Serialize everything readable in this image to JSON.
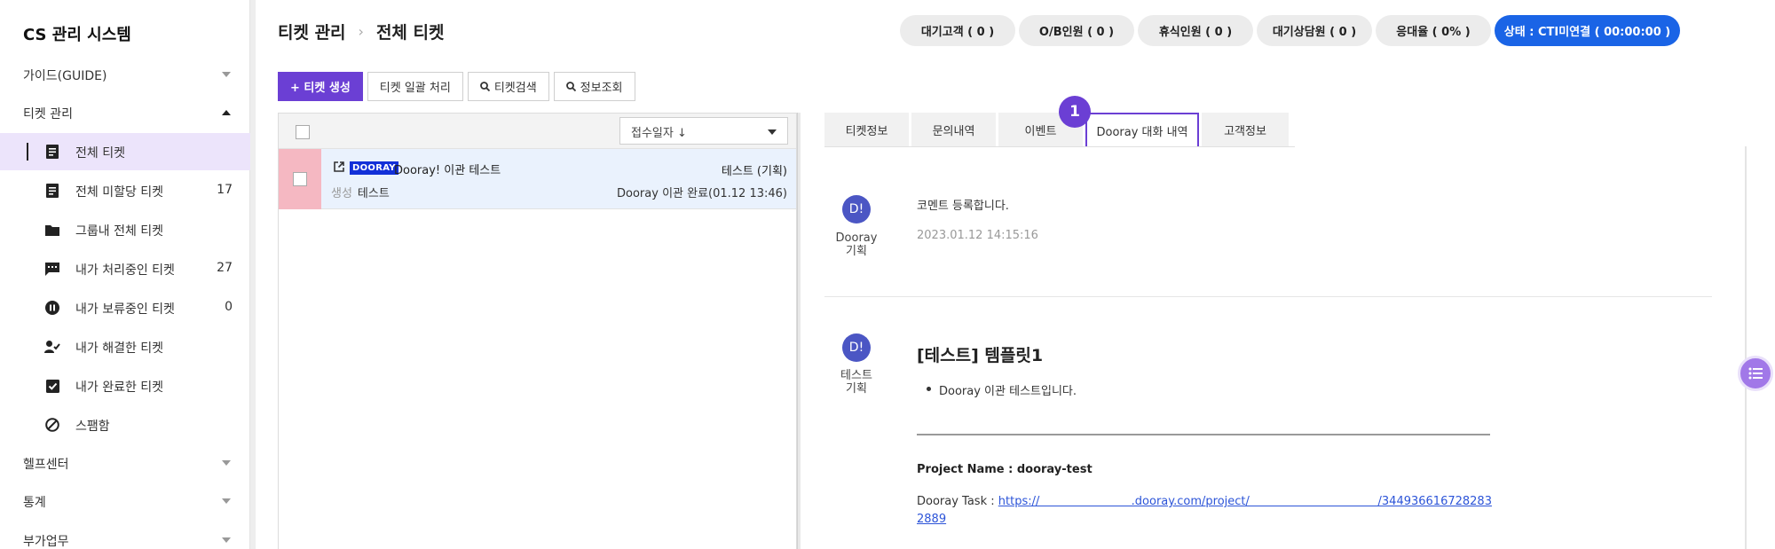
{
  "app": {
    "title": "CS 관리 시스템"
  },
  "sidebar": {
    "guide": "가이드(GUIDE)",
    "ticket_mgmt": "티켓 관리",
    "items": [
      {
        "label": "전체 티켓",
        "count": "",
        "icon": "document-icon"
      },
      {
        "label": "전체 미할당 티켓",
        "count": "17",
        "icon": "document-icon"
      },
      {
        "label": "그룹내 전체 티켓",
        "count": "",
        "icon": "folder-icon"
      },
      {
        "label": "내가 처리중인 티켓",
        "count": "27",
        "icon": "chat-icon"
      },
      {
        "label": "내가 보류중인 티켓",
        "count": "0",
        "icon": "pause-icon"
      },
      {
        "label": "내가 해결한 티켓",
        "count": "",
        "icon": "user-check-icon"
      },
      {
        "label": "내가 완료한 티켓",
        "count": "",
        "icon": "checkbox-icon"
      },
      {
        "label": "스팸함",
        "count": "",
        "icon": "block-icon"
      }
    ],
    "helpcenter": "헬프센터",
    "stats": "통계",
    "extra": "부가업무"
  },
  "header": {
    "breadcrumb_root": "티켓 관리",
    "breadcrumb_current": "전체 티켓",
    "pills": {
      "waiting_customers": "대기고객 ( 0 )",
      "ob_agents": "O/B인원 ( 0 )",
      "resting_agents": "휴식인원 ( 0 )",
      "waiting_agents": "대기상담원 ( 0 )",
      "response_rate": "응대율 ( 0% )",
      "status": "상태 : CTI미연결 ( 00:00:00 )"
    }
  },
  "toolbar": {
    "create": "+ 티켓 생성",
    "bulk": "티켓 일괄 처리",
    "search": "티켓검색",
    "info": "정보조회"
  },
  "list": {
    "sort_label": "접수일자 ↓",
    "ticket": {
      "brand": "DOORAY",
      "title": "Dooray! 이관 테스트",
      "tag": "생성",
      "customer": "테스트",
      "assignee": "테스트 (기획)",
      "state": "Dooray 이관 완료(01.12 13:46)"
    }
  },
  "tabs": {
    "ticket_info": "티켓정보",
    "inquiry": "문의내역",
    "event": "이벤트",
    "dooray": "Dooray 대화 내역",
    "customer": "고객정보",
    "badge": "1"
  },
  "comments": {
    "first": {
      "avatar": "D!",
      "author_line1": "Dooray",
      "author_line2": "기획",
      "text": "코멘트 등록합니다.",
      "date": "2023.01.12 14:15:16"
    },
    "second": {
      "avatar": "D!",
      "author_line1": "테스트",
      "author_line2": "기획",
      "heading": "[테스트] 템플릿1",
      "bullet": "Dooray 이관 테스트입니다.",
      "project": "Project Name : dooray-test",
      "task_label": "Dooray Task : ",
      "task_link": "https://                         .dooray.com/project/                                   /3449366167282832889"
    }
  },
  "colors": {
    "accent": "#6b3fd4",
    "active_bg": "#ece4fb",
    "status_blue": "#1a64e6",
    "row_highlight": "#eaf2fd",
    "flag_pink": "#f5b8c2",
    "avatar": "#4b56c4"
  }
}
